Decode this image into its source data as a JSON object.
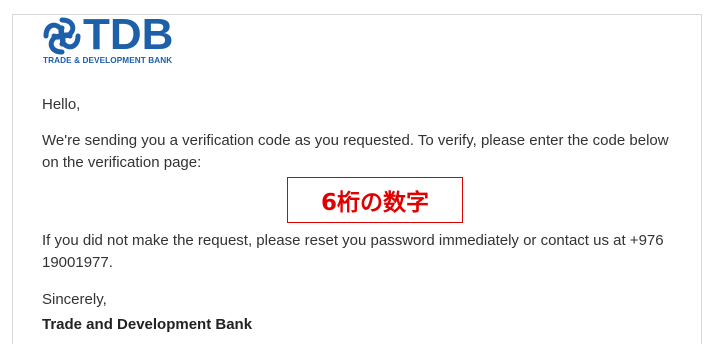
{
  "logo": {
    "wordmark": "TDB",
    "tagline": "TRADE & DEVELOPMENT BANK",
    "icon": "tdb-knot-icon",
    "brand_color": "#1d5fa8"
  },
  "email": {
    "greeting": "Hello,",
    "paragraph1": "We're sending you a verification code as you requested. To verify, please enter the code below on the verification page:",
    "code_annotation": "6桁の数字",
    "paragraph2": "If you did not make the request, please reset you password immediately or contact us at +976 19001977.",
    "closing": "Sincerely,",
    "signature": "Trade and Development Bank"
  },
  "colors": {
    "annotation": "#e00000",
    "text": "#333333"
  }
}
